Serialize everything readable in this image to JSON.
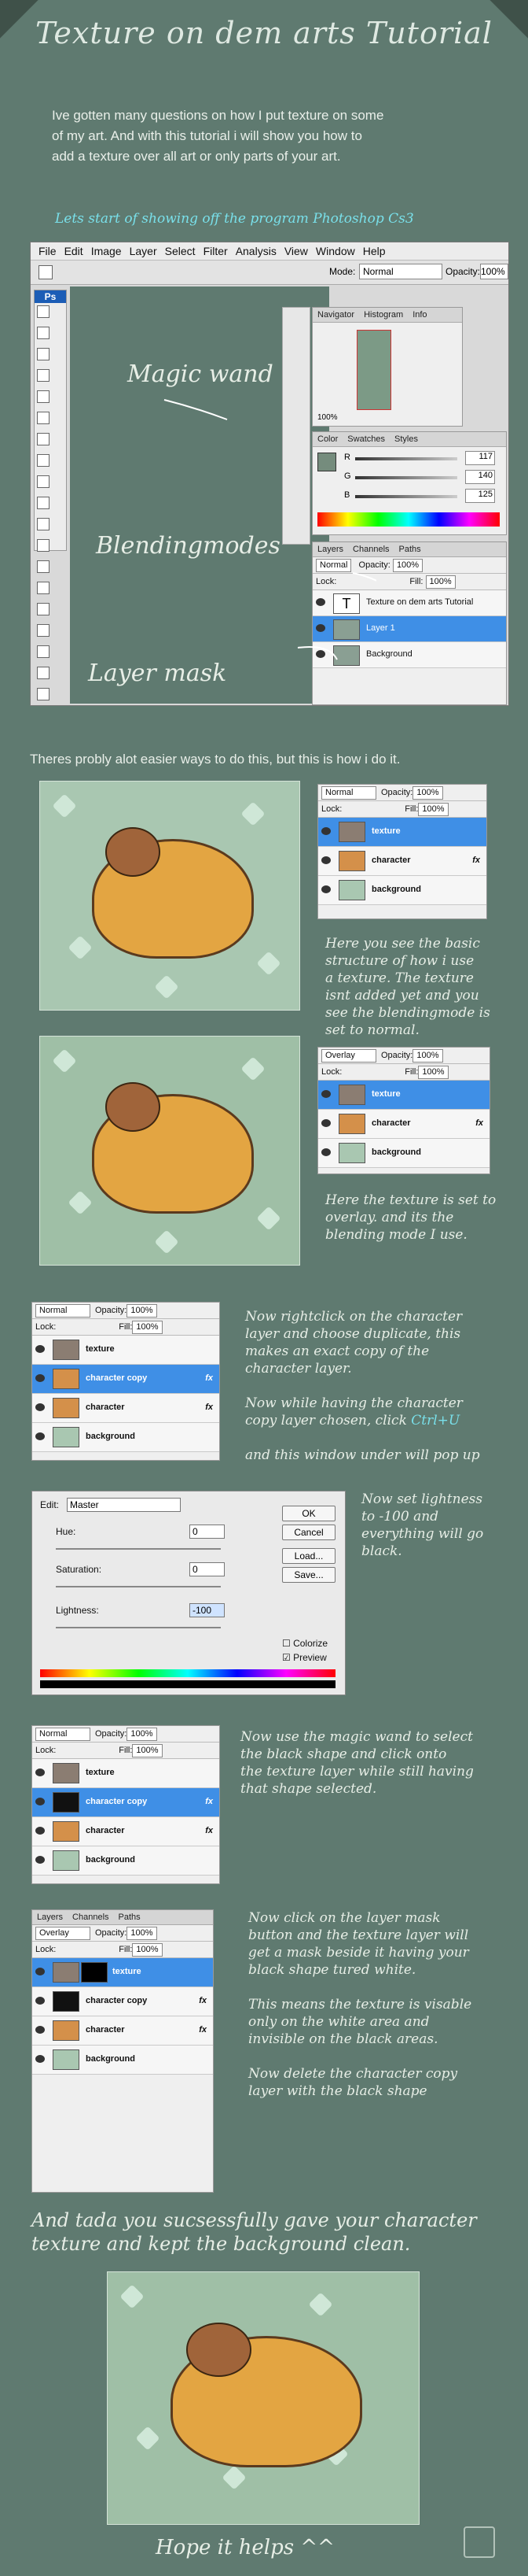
{
  "title": "Texture on dem arts Tutorial",
  "intro": {
    "line1": "Ive gotten many questions on how I put texture on some",
    "line2": "of my art. And with this tutorial i will show you how to",
    "line3": "add a texture over all art or only parts of your art.",
    "highlight": "Lets start of showing off the program Photoshop Cs3"
  },
  "photoshop": {
    "menu": [
      "File",
      "Edit",
      "Image",
      "Layer",
      "Select",
      "Filter",
      "Analysis",
      "View",
      "Window",
      "Help"
    ],
    "mode_label": "Mode:",
    "mode_value": "Normal",
    "opacity_label": "Opacity:",
    "opacity_value": "100%",
    "tabs_nav": [
      "Navigator",
      "Histogram",
      "Info"
    ],
    "zoom": "100%",
    "tabs_color": [
      "Color",
      "Swatches",
      "Styles"
    ],
    "rgb": [
      {
        "ch": "R",
        "v": "117"
      },
      {
        "ch": "G",
        "v": "140"
      },
      {
        "ch": "B",
        "v": "125"
      }
    ],
    "tabs_layers": [
      "Layers",
      "Channels",
      "Paths"
    ],
    "blend": "Normal",
    "lock_label": "Lock:",
    "fill_label": "Fill:",
    "layers": [
      {
        "name": "Texture on dem arts Tutorial",
        "type": "text"
      },
      {
        "name": "Layer 1",
        "type": "selected"
      },
      {
        "name": "Background",
        "type": "bg"
      }
    ],
    "ps_logo": "Ps"
  },
  "annotations": {
    "magic_wand": "Magic wand",
    "blending": "Blendingmodes",
    "layer_mask": "Layer mask"
  },
  "step0": "Theres probly alot easier ways to do this, but this is how i do it.",
  "panel_a": {
    "blend": "Normal",
    "opacity_label": "Opacity:",
    "opacity": "100%",
    "lock": "Lock:",
    "fill_label": "Fill:",
    "fill": "100%",
    "layers": [
      "texture",
      "character",
      "background"
    ]
  },
  "text_a": [
    "Here you see the basic",
    "structure of how i use",
    "a texture. The texture",
    "isnt added yet and you",
    "see the blendingmode is",
    "set to normal."
  ],
  "panel_b": {
    "blend": "Overlay",
    "opacity_label": "Opacity:",
    "opacity": "100%",
    "lock": "Lock:",
    "fill_label": "Fill:",
    "fill": "100%",
    "layers": [
      "texture",
      "character",
      "background"
    ]
  },
  "text_b": [
    "Here the texture is set to",
    "overlay. and its the",
    "blending mode I use."
  ],
  "panel_c": {
    "blend": "Normal",
    "opacity_label": "Opacity:",
    "opacity": "100%",
    "lock": "Lock:",
    "fill_label": "Fill:",
    "fill": "100%",
    "layers": [
      "texture",
      "character copy",
      "character",
      "background"
    ]
  },
  "text_c": {
    "p1": [
      "Now rightclick on the character",
      "layer and choose duplicate, this",
      "makes an exact copy of the",
      "character layer."
    ],
    "p2a": [
      "Now while having the character",
      "copy layer chosen, click "
    ],
    "shortcut": "Ctrl+U",
    "p3": "and this window under will pop up"
  },
  "dialog": {
    "edit_label": "Edit:",
    "edit_value": "Master",
    "hue": "Hue:",
    "hue_v": "0",
    "sat": "Saturation:",
    "sat_v": "0",
    "light": "Lightness:",
    "light_v": "-100",
    "ok": "OK",
    "cancel": "Cancel",
    "load": "Load...",
    "save": "Save...",
    "colorize": "Colorize",
    "preview": "Preview"
  },
  "text_d": [
    "Now set lightness",
    "to -100 and",
    "everything will go",
    "black."
  ],
  "panel_e": {
    "blend": "Normal",
    "opacity_label": "Opacity:",
    "opacity": "100%",
    "lock": "Lock:",
    "fill_label": "Fill:",
    "fill": "100%",
    "layers": [
      "texture",
      "character copy",
      "character",
      "background"
    ]
  },
  "text_e": [
    "Now  use the magic wand to select",
    "the black shape  and click onto",
    "the texture layer while still having",
    "that shape selected."
  ],
  "panel_f": {
    "tabs": [
      "Layers",
      "Channels",
      "Paths"
    ],
    "blend": "Overlay",
    "opacity_label": "Opacity:",
    "opacity": "100%",
    "lock": "Lock:",
    "fill_label": "Fill:",
    "fill": "100%",
    "layers": [
      "texture",
      "character copy",
      "character",
      "background"
    ]
  },
  "text_f": {
    "p1": [
      "Now click on the layer mask",
      "button and the texture layer will",
      "get a mask beside it having your",
      "black shape tured white."
    ],
    "p2": [
      "This means the texture is visable",
      "only on the white area and",
      "invisible on the black areas."
    ],
    "p3": [
      "Now delete the character copy",
      "layer with the black shape"
    ]
  },
  "final": [
    "And tada you sucsessfully gave your character",
    "texture and  kept the background clean."
  ],
  "outro": "Hope it helps ^^",
  "colors": {
    "bg": "#5f7a70",
    "text": "#e9efe9",
    "accent": "#79e0ea",
    "select": "#3f8fe6"
  }
}
